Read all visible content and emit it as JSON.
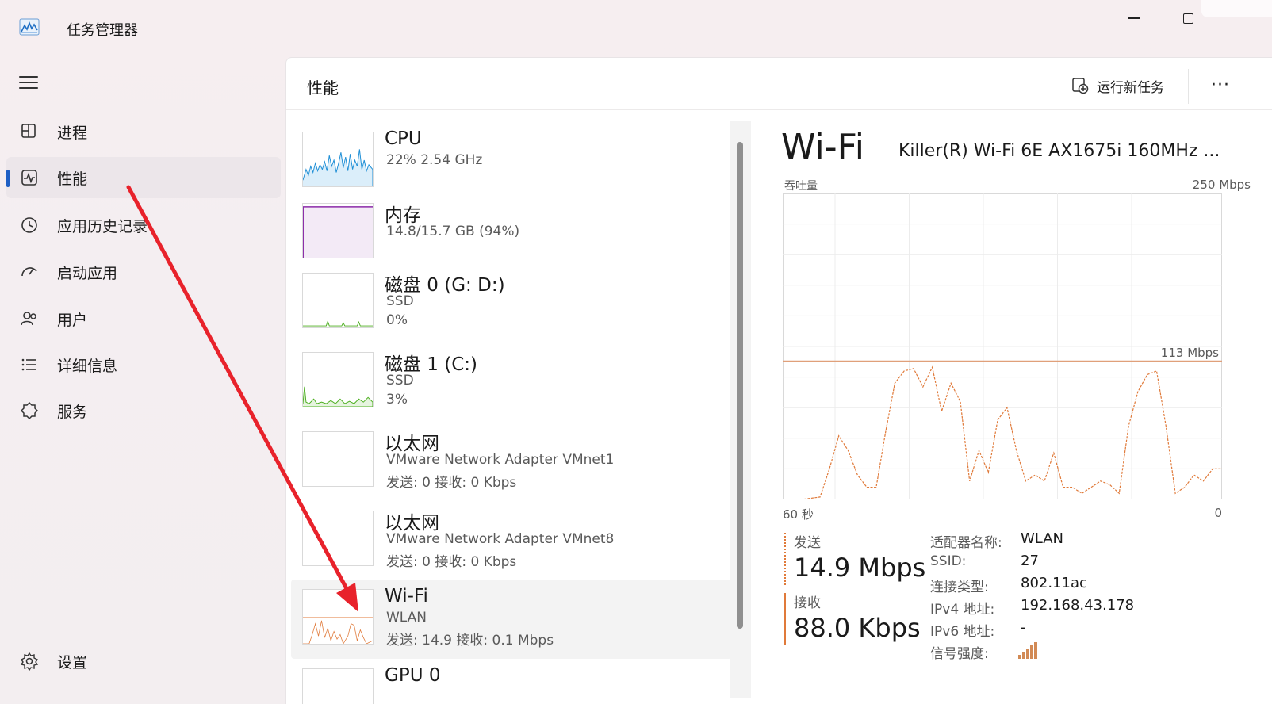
{
  "app": {
    "title": "任务管理器",
    "icon": "performance-chart-icon"
  },
  "window_controls": {
    "minimize": "minimize-icon",
    "maximize": "maximize-icon"
  },
  "sidebar": {
    "menu_icon": "hamburger-icon",
    "items": [
      {
        "label": "进程",
        "icon": "processes-icon",
        "active": false
      },
      {
        "label": "性能",
        "icon": "performance-icon",
        "active": true
      },
      {
        "label": "应用历史记录",
        "icon": "history-icon",
        "active": false
      },
      {
        "label": "启动应用",
        "icon": "startup-icon",
        "active": false
      },
      {
        "label": "用户",
        "icon": "users-icon",
        "active": false
      },
      {
        "label": "详细信息",
        "icon": "details-icon",
        "active": false
      },
      {
        "label": "服务",
        "icon": "services-icon",
        "active": false
      }
    ],
    "settings": {
      "label": "设置",
      "icon": "settings-icon"
    }
  },
  "header": {
    "title": "性能",
    "run_task": "运行新任务",
    "more": "···"
  },
  "devices": [
    {
      "name": "CPU",
      "sub1": "22%  2.54 GHz",
      "sub2": "",
      "color": "#1f8fd6"
    },
    {
      "name": "内存",
      "sub1": "14.8/15.7 GB (94%)",
      "sub2": "",
      "color": "#8a2aa8"
    },
    {
      "name": "磁盘 0 (G: D:)",
      "sub1": "SSD",
      "sub2": "0%",
      "color": "#4caf1f"
    },
    {
      "name": "磁盘 1 (C:)",
      "sub1": "SSD",
      "sub2": "3%",
      "color": "#4caf1f"
    },
    {
      "name": "以太网",
      "sub1": "VMware Network Adapter VMnet1",
      "sub2": "发送: 0 接收: 0 Kbps",
      "color": "#c77a3a"
    },
    {
      "name": "以太网",
      "sub1": "VMware Network Adapter VMnet8",
      "sub2": "发送: 0 接收: 0 Kbps",
      "color": "#c77a3a"
    },
    {
      "name": "Wi-Fi",
      "sub1": "WLAN",
      "sub2": "发送: 14.9 接收: 0.1 Mbps",
      "color": "#e07a3a"
    },
    {
      "name": "GPU 0",
      "sub1": "",
      "sub2": "",
      "color": "#1f8fd6"
    }
  ],
  "detail": {
    "title": "Wi-Fi",
    "adapter": "Killer(R) Wi-Fi 6E AX1675i 160MHz ...",
    "axis_label": "吞吐量",
    "axis_max": "250 Mbps",
    "ref_label": "113 Mbps",
    "x_left": "60 秒",
    "x_right": "0",
    "send_label": "发送",
    "send_value": "14.9 Mbps",
    "recv_label": "接收",
    "recv_value": "88.0 Kbps",
    "props": [
      {
        "label": "适配器名称:",
        "value": "WLAN"
      },
      {
        "label": "SSID:",
        "value": "27"
      },
      {
        "label": "连接类型:",
        "value": "802.11ac"
      },
      {
        "label": "IPv4 地址:",
        "value": "192.168.43.178"
      },
      {
        "label": "IPv6 地址:",
        "value": "-"
      },
      {
        "label": "信号强度:",
        "value": ""
      }
    ],
    "signal_icon": "signal-strength-icon"
  },
  "chart_data": {
    "type": "line",
    "title": "",
    "ylabel": "吞吐量",
    "ylim": [
      0,
      250
    ],
    "xlim": [
      60,
      0
    ],
    "reference_line": 113,
    "series": [
      {
        "name": "发送",
        "color": "#e07a3a",
        "values": [
          0,
          0,
          0,
          1,
          2,
          25,
          52,
          40,
          20,
          10,
          10,
          55,
          95,
          105,
          107,
          92,
          108,
          72,
          95,
          80,
          15,
          40,
          22,
          65,
          75,
          40,
          15,
          20,
          15,
          38,
          10,
          10,
          5,
          10,
          15,
          12,
          5,
          60,
          88,
          102,
          105,
          60,
          5,
          10,
          20,
          15,
          25,
          25
        ]
      }
    ]
  }
}
